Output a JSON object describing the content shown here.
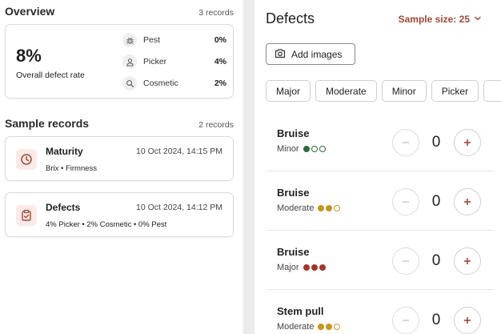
{
  "overview": {
    "title": "Overview",
    "count": "3 records",
    "rate": "8%",
    "rate_label": "Overall defect rate",
    "categories": [
      {
        "name": "Pest",
        "pct": "0%",
        "icon": "bug-icon"
      },
      {
        "name": "Picker",
        "pct": "4%",
        "icon": "person-icon"
      },
      {
        "name": "Cosmetic",
        "pct": "2%",
        "icon": "magnifier-icon"
      }
    ]
  },
  "samples": {
    "title": "Sample records",
    "count": "2 records",
    "records": [
      {
        "title": "Maturity",
        "time": "10 Oct 2024, 14:15 PM",
        "sub": "Brix • Firmness",
        "icon": "clock-icon"
      },
      {
        "title": "Defects",
        "time": "10 Oct 2024, 14:12 PM",
        "sub": "4% Picker • 2% Cosmetic • 0% Pest",
        "icon": "clipboard-check-icon"
      }
    ]
  },
  "defects": {
    "title": "Defects",
    "sample_size": "Sample size: 25",
    "add_images": "Add images",
    "chips": [
      "Major",
      "Moderate",
      "Minor",
      "Picker"
    ],
    "rows": [
      {
        "name": "Bruise",
        "severity": "Minor",
        "count": "0"
      },
      {
        "name": "Bruise",
        "severity": "Moderate",
        "count": "0"
      },
      {
        "name": "Bruise",
        "severity": "Major",
        "count": "0"
      },
      {
        "name": "Stem pull",
        "severity": "Moderate",
        "count": "0"
      }
    ]
  },
  "colors": {
    "accent": "#a34634",
    "minor": "#2e6b3f",
    "moderate": "#c9941c",
    "major": "#a5352a"
  }
}
